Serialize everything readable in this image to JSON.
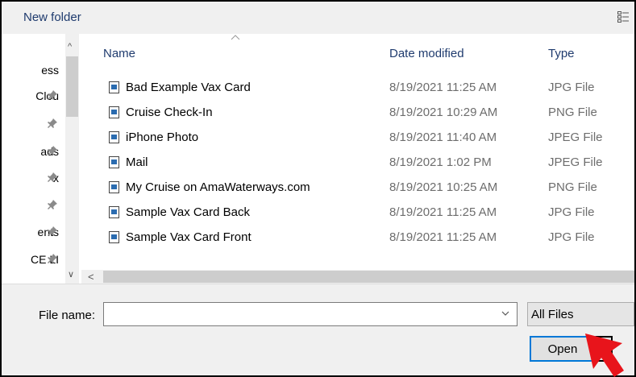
{
  "toolbar": {
    "new_folder_label": "New folder"
  },
  "nav_pane": {
    "items": [
      {
        "label": "ess",
        "pinned": false
      },
      {
        "label": "Clou",
        "pinned": true
      },
      {
        "label": "",
        "pinned": true
      },
      {
        "label": "ads",
        "pinned": true
      },
      {
        "label": "x",
        "pinned": true
      },
      {
        "label": "",
        "pinned": true
      },
      {
        "label": "ents",
        "pinned": true
      },
      {
        "label": "CE LI",
        "pinned": true
      }
    ]
  },
  "columns": {
    "name": "Name",
    "date_modified": "Date modified",
    "type": "Type"
  },
  "files": [
    {
      "name": "Bad Example Vax Card",
      "date": "8/19/2021 11:25 AM",
      "type": "JPG File"
    },
    {
      "name": "Cruise Check-In",
      "date": "8/19/2021 10:29 AM",
      "type": "PNG File"
    },
    {
      "name": "iPhone Photo",
      "date": "8/19/2021 11:40 AM",
      "type": "JPEG File"
    },
    {
      "name": "Mail",
      "date": "8/19/2021 1:02 PM",
      "type": "JPEG File"
    },
    {
      "name": "My Cruise on AmaWaterways.com",
      "date": "8/19/2021 10:25 AM",
      "type": "PNG File"
    },
    {
      "name": "Sample Vax Card Back",
      "date": "8/19/2021 11:25 AM",
      "type": "JPG File"
    },
    {
      "name": "Sample Vax Card Front",
      "date": "8/19/2021 11:25 AM",
      "type": "JPG File"
    }
  ],
  "bottom": {
    "file_name_label": "File name:",
    "file_name_value": "",
    "filter_label": "All Files",
    "open_label": "Open"
  },
  "colors": {
    "accent": "#0078d7",
    "header_text": "#1f3b6e",
    "annotation_arrow": "#e8141b"
  }
}
